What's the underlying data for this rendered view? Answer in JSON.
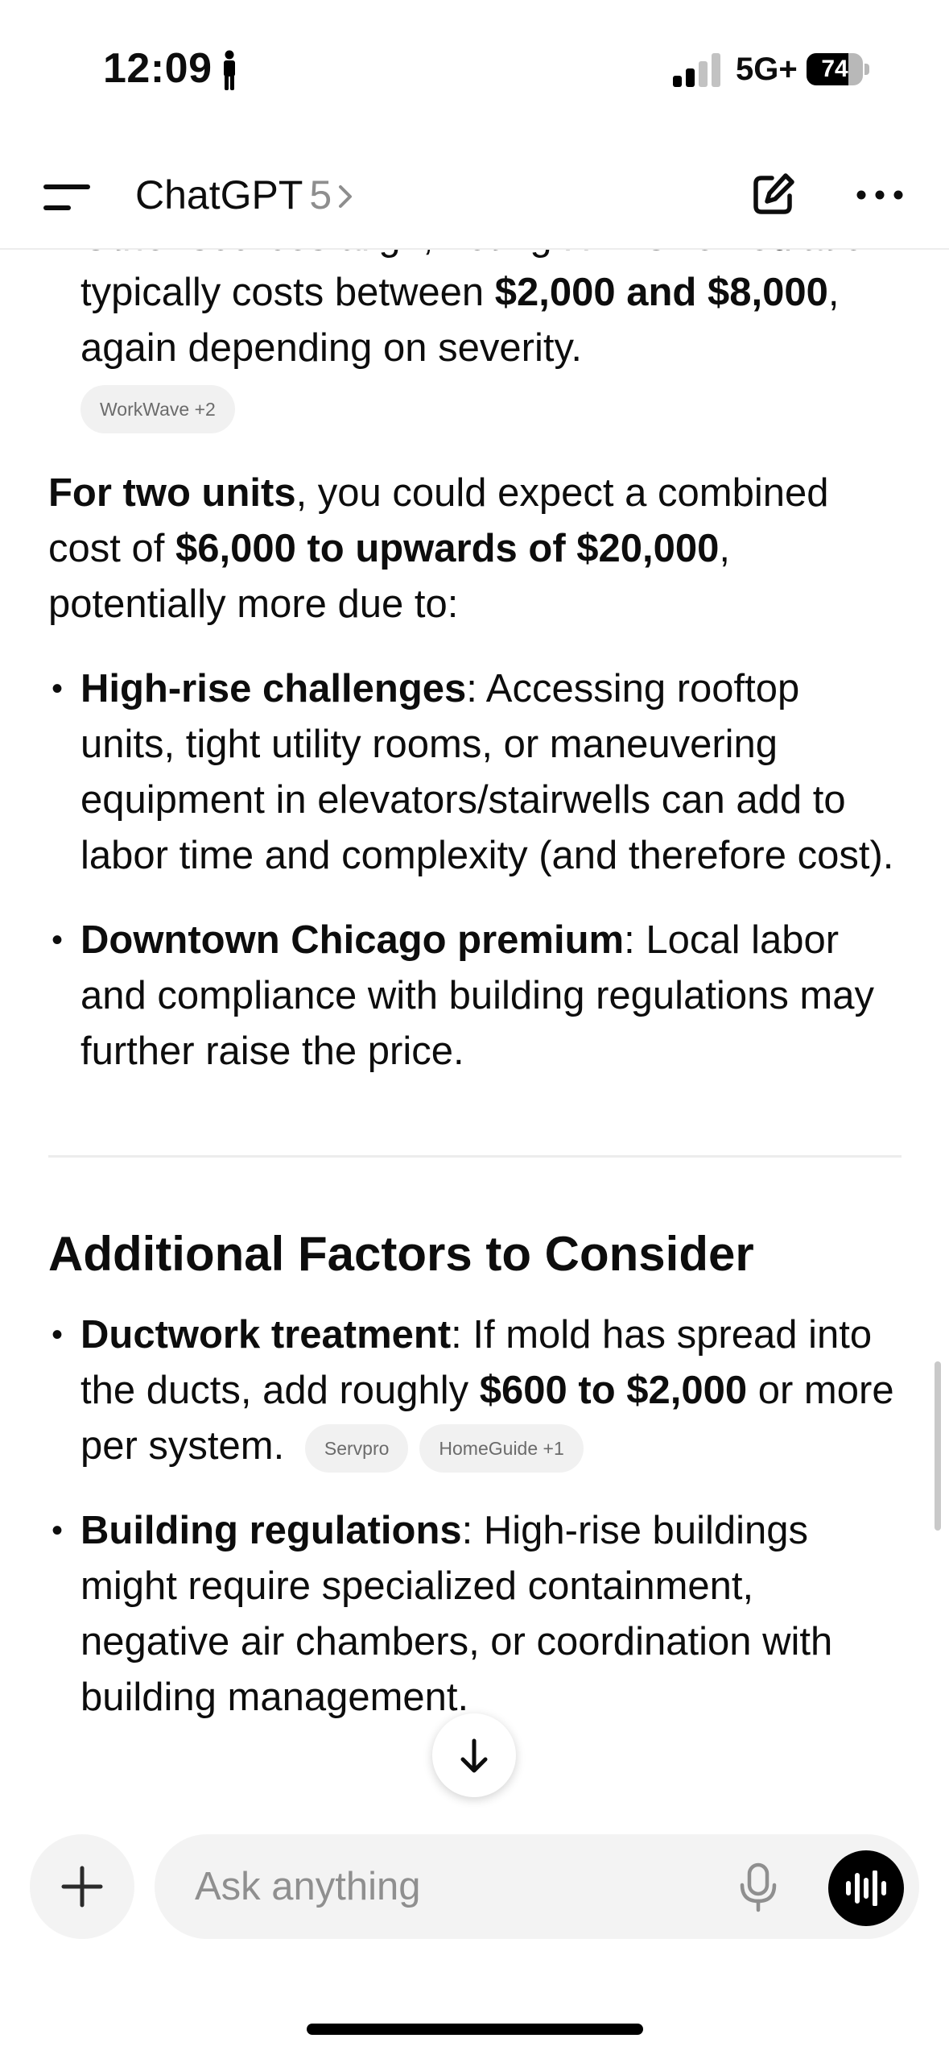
{
  "status_bar": {
    "time": "12:09",
    "network": "5G+",
    "battery": "74",
    "battery_level": 0.74
  },
  "header": {
    "title": "ChatGPT",
    "version": "5"
  },
  "content": {
    "bullet0": {
      "text1": "Other sources align, noting HVAC remediation typically costs between ",
      "bold1": "$2,000 and $8,000",
      "text2": ", again depending on severity.",
      "chip": "WorkWave +2"
    },
    "para1": {
      "bold1": "For two units",
      "text1": ", you could expect a combined cost of ",
      "bold2": "$6,000 to upwards of $20,000",
      "text2": ", potentially more due to:"
    },
    "bullet1": {
      "bold": "High-rise challenges",
      "text": ": Accessing rooftop units, tight utility rooms, or maneuvering equipment in elevators/stairwells can add to labor time and complexity (and therefore cost)."
    },
    "bullet2": {
      "bold": "Downtown Chicago premium",
      "text": ": Local labor and compliance with building regulations may further raise the price."
    },
    "heading": "Additional Factors to Consider",
    "bullet3": {
      "bold1": "Ductwork treatment",
      "text1": ": If mold has spread into the ducts, add roughly ",
      "bold2": "$600 to $2,000",
      "text2": " or more per system.",
      "chip1": "Servpro",
      "chip2": "HomeGuide +1"
    },
    "bullet4": {
      "bold": "Building regulations",
      "text": ": High-rise buildings might require specialized containment, negative air chambers, or coordination with building management."
    }
  },
  "composer": {
    "placeholder": "Ask anything"
  },
  "icons": {
    "menu": "menu-icon",
    "chevron": "chevron-right-icon",
    "edit": "new-chat-icon",
    "more": "more-icon",
    "scroll": "arrow-down-icon",
    "plus": "plus-icon",
    "mic": "microphone-icon",
    "voice": "voice-mode-icon"
  }
}
